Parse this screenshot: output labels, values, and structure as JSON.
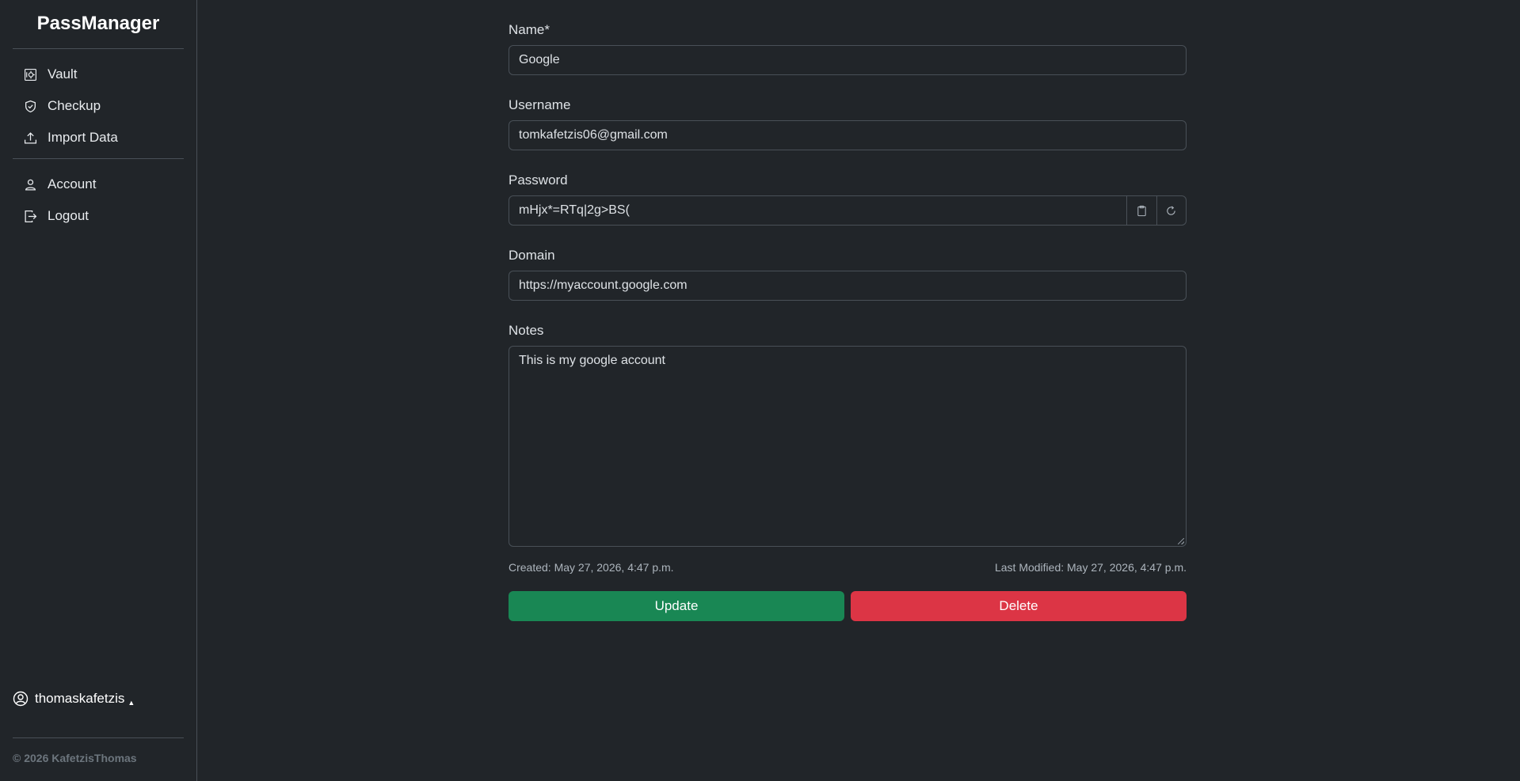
{
  "app": {
    "brand": "PassManager"
  },
  "sidebar": {
    "items": [
      {
        "label": "Vault",
        "icon": "safe-icon"
      },
      {
        "label": "Checkup",
        "icon": "shield-check-icon"
      },
      {
        "label": "Import Data",
        "icon": "upload-icon"
      }
    ],
    "account_items": [
      {
        "label": "Account",
        "icon": "person-icon"
      },
      {
        "label": "Logout",
        "icon": "logout-icon"
      }
    ],
    "user": "thomaskafetzis",
    "copyright": "© 2026 KafetzisThomas"
  },
  "form": {
    "name_label": "Name*",
    "name_value": "Google",
    "username_label": "Username",
    "username_value": "tomkafetzis06@gmail.com",
    "password_label": "Password",
    "password_value": "mHjx*=RTq|2g>BS(",
    "domain_label": "Domain",
    "domain_value": "https://myaccount.google.com",
    "notes_label": "Notes",
    "notes_value": "This is my google account",
    "created": "Created: May 27, 2026, 4:47 p.m.",
    "modified": "Last Modified: May 27, 2026, 4:47 p.m.",
    "update_label": "Update",
    "delete_label": "Delete"
  },
  "colors": {
    "background": "#212529",
    "border": "#495057",
    "update": "#198754",
    "delete": "#dc3545"
  }
}
